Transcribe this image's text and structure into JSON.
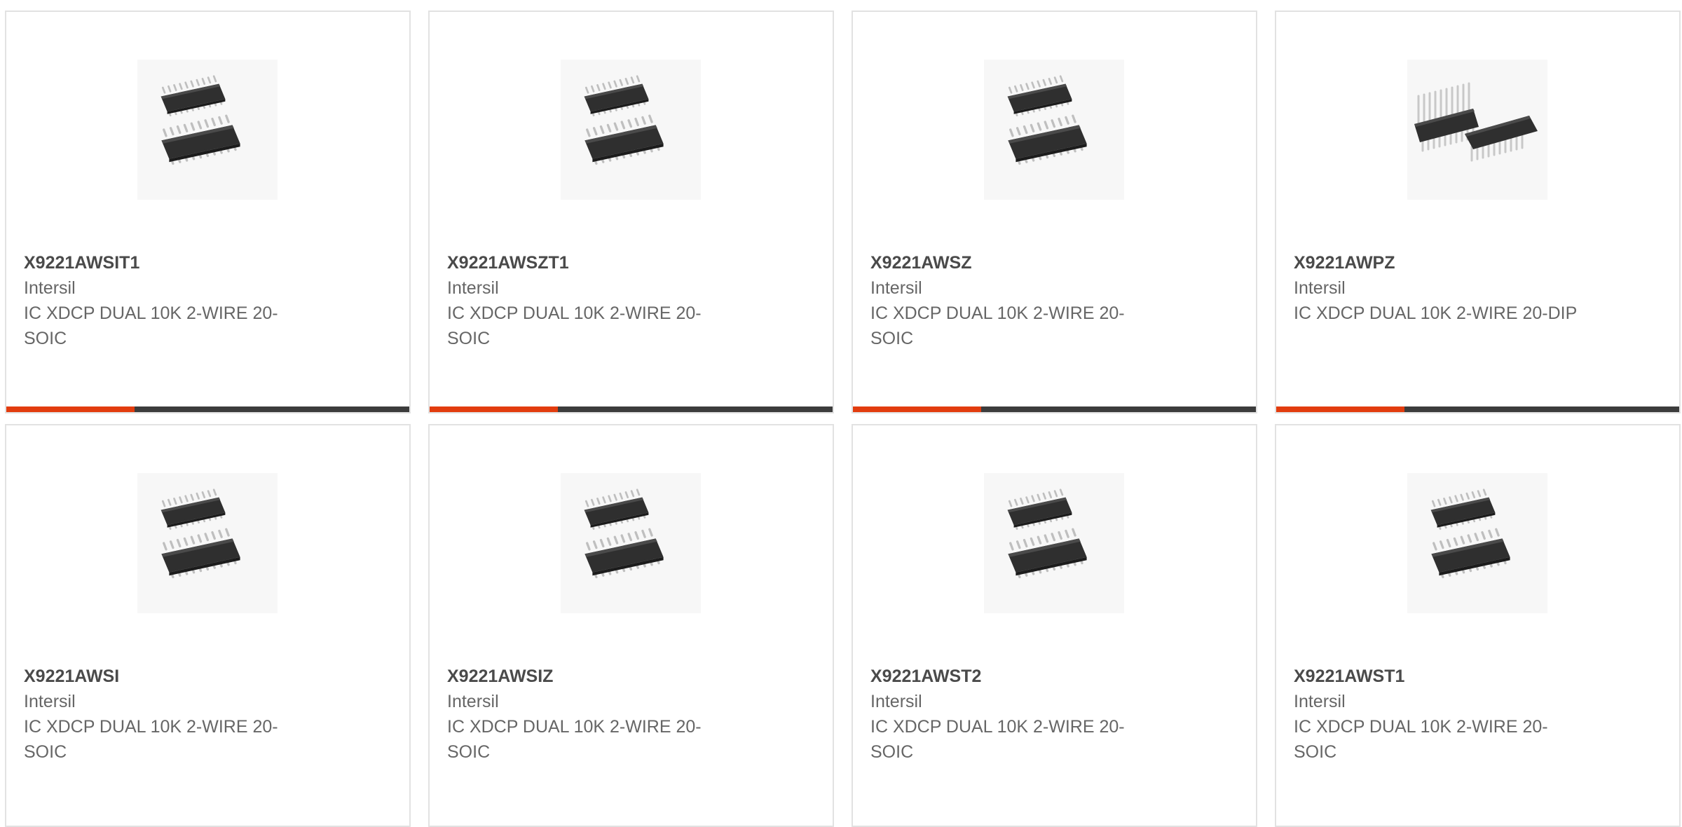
{
  "accent_color": "#e23c0e",
  "bar_color": "#3c3c3c",
  "products": [
    {
      "part_number": "X9221AWSIT1",
      "manufacturer": "Intersil",
      "description": "IC XDCP DUAL 10K 2-WIRE 20-SOIC",
      "image_icon": "soic-chip-icon"
    },
    {
      "part_number": "X9221AWSZT1",
      "manufacturer": "Intersil",
      "description": "IC XDCP DUAL 10K 2-WIRE 20-SOIC",
      "image_icon": "soic-chip-icon"
    },
    {
      "part_number": "X9221AWSZ",
      "manufacturer": "Intersil",
      "description": "IC XDCP DUAL 10K 2-WIRE 20-SOIC",
      "image_icon": "soic-chip-icon"
    },
    {
      "part_number": "X9221AWPZ",
      "manufacturer": "Intersil",
      "description": "IC XDCP DUAL 10K 2-WIRE 20-DIP",
      "image_icon": "dip-chip-icon"
    },
    {
      "part_number": "X9221AWSI",
      "manufacturer": "Intersil",
      "description": "IC XDCP DUAL 10K 2-WIRE 20-SOIC",
      "image_icon": "soic-chip-icon"
    },
    {
      "part_number": "X9221AWSIZ",
      "manufacturer": "Intersil",
      "description": "IC XDCP DUAL 10K 2-WIRE 20-SOIC",
      "image_icon": "soic-chip-icon"
    },
    {
      "part_number": "X9221AWST2",
      "manufacturer": "Intersil",
      "description": "IC XDCP DUAL 10K 2-WIRE 20-SOIC",
      "image_icon": "soic-chip-icon"
    },
    {
      "part_number": "X9221AWST1",
      "manufacturer": "Intersil",
      "description": "IC XDCP DUAL 10K 2-WIRE 20-SOIC",
      "image_icon": "soic-chip-icon"
    }
  ]
}
